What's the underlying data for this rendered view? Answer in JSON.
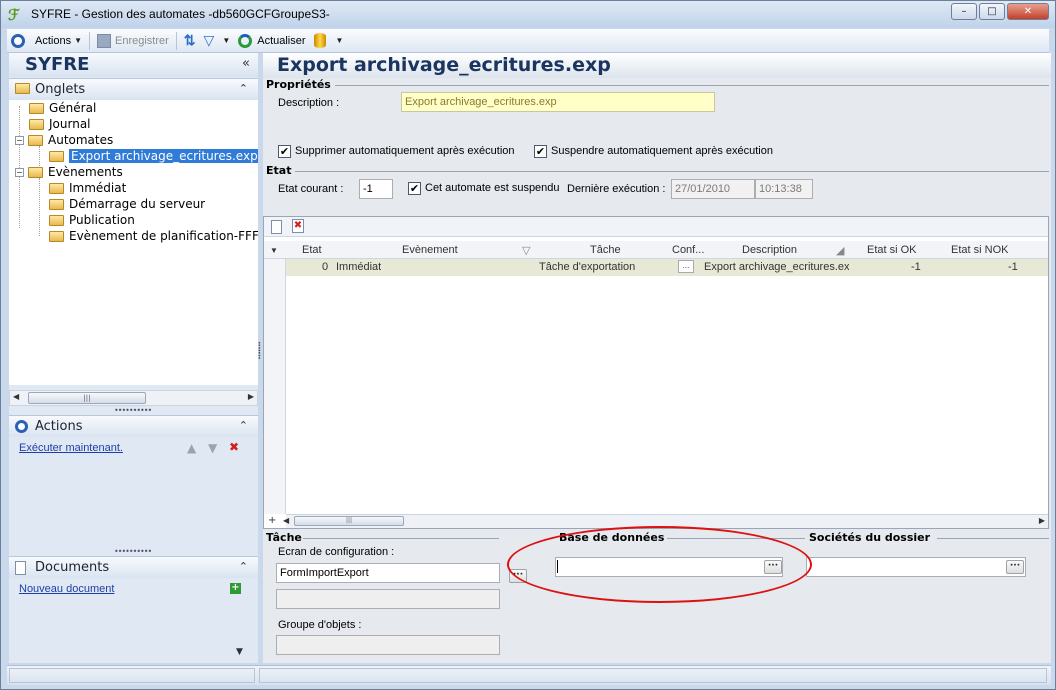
{
  "window": {
    "title": "SYFRE -  Gestion des automates -db560GCFGroupeS3-",
    "min_glyph": "–",
    "max_glyph": "□",
    "close_glyph": "✕"
  },
  "toolbar": {
    "actions_label": "Actions",
    "save_label": "Enregistrer",
    "refresh_label": "Actualiser"
  },
  "left": {
    "title": "SYFRE",
    "collapse_glyph": "«",
    "onglets": {
      "label": "Onglets",
      "tree": [
        {
          "label": "Général",
          "level": 0
        },
        {
          "label": "Journal",
          "level": 0
        },
        {
          "label": "Automates",
          "level": 0,
          "expander": "−"
        },
        {
          "label": "Export archivage_ecritures.exp",
          "level": 1,
          "selected": true
        },
        {
          "label": "Evènements",
          "level": 0,
          "expander": "−"
        },
        {
          "label": "Immédiat",
          "level": 1
        },
        {
          "label": "Démarrage du serveur",
          "level": 1
        },
        {
          "label": "Publication",
          "level": 1
        },
        {
          "label": "Evènement de planification-FFFFFF",
          "level": 1
        }
      ]
    },
    "actions": {
      "label": "Actions",
      "link": "Exécuter maintenant."
    },
    "documents": {
      "label": "Documents",
      "link": "Nouveau document"
    }
  },
  "main": {
    "title": "Export archivage_ecritures.exp",
    "proprietes": {
      "label": "Propriétés",
      "description_label": "Description :",
      "description_value": "Export archivage_ecritures.exp",
      "suppr_label": "Supprimer automatiquement après exécution",
      "suppr_checked": true,
      "suspend_label": "Suspendre automatiquement après exécution",
      "suspend_checked": true
    },
    "etat": {
      "label": "Etat",
      "courant_label": "Etat courant :",
      "courant_value": "-1",
      "suspendu_label": "Cet automate est suspendu",
      "suspendu_checked": true,
      "derniere_label": "Dernière exécution :",
      "derniere_date": "27/01/2010",
      "derniere_time": "10:13:38"
    },
    "grid": {
      "columns": [
        "Etat",
        "Evènement",
        "Tâche",
        "Conf...",
        "Description",
        "Etat si OK",
        "Etat si NOK"
      ],
      "rows": [
        {
          "etat": "0",
          "evenement": "Immédiat",
          "tache": "Tâche d'exportation",
          "conf": "...",
          "description": "Export archivage_ecritures.exp",
          "ok": "-1",
          "nok": "-1"
        }
      ]
    },
    "tache": {
      "label": "Tâche",
      "ecran_label": "Ecran de configuration :",
      "ecran_value": "FormImportExport",
      "groupe_label": "Groupe d'objets :"
    },
    "base": {
      "label": "Base de données",
      "value": ""
    },
    "societes": {
      "label": "Sociétés du dossier",
      "value": ""
    }
  },
  "colors": {
    "title_blue": "#1b3561",
    "selection": "#2f7bd8",
    "annotation_red": "#dd1111",
    "link": "#1f3fa8"
  }
}
